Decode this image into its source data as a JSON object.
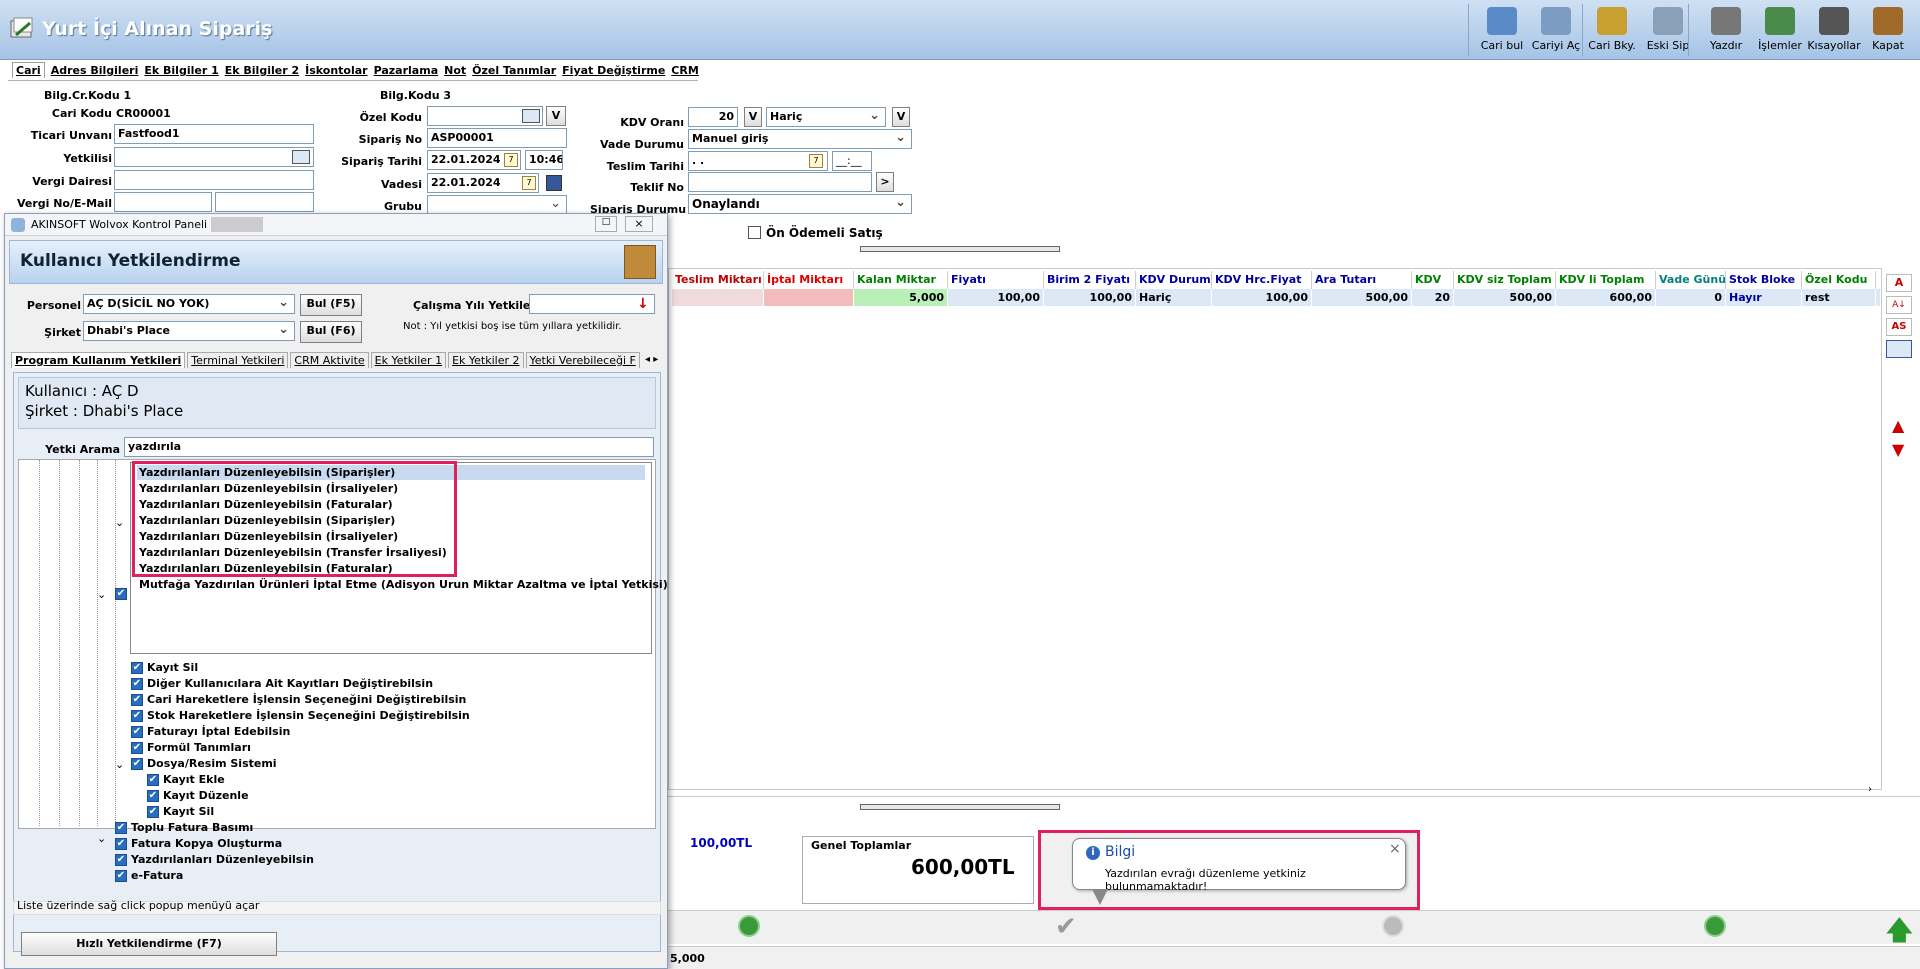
{
  "window": {
    "title": "Yurt İçi Alınan Sipariş"
  },
  "toolbar": [
    {
      "label": "Cari bul",
      "icon": "user-search-icon"
    },
    {
      "label": "Cariyi Aç",
      "icon": "user-open-icon"
    },
    {
      "label": "Cari Bky.",
      "icon": "balance-icon"
    },
    {
      "label": "Eski Sip",
      "icon": "old-orders-icon"
    },
    {
      "label": "Yazdır",
      "icon": "printer-icon"
    },
    {
      "label": "İşlemler",
      "icon": "operations-icon"
    },
    {
      "label": "Kısayollar",
      "icon": "keyboard-icon"
    },
    {
      "label": "Kapat",
      "icon": "exit-door-icon"
    }
  ],
  "tabs": [
    "Cari",
    "Adres Bilgileri",
    "Ek Bilgiler 1",
    "Ek Bilgiler 2",
    "İskontolar",
    "Pazarlama",
    "Not",
    "Özel Tanımlar",
    "Fiyat Değiştirme",
    "CRM"
  ],
  "form": {
    "bilg_cr_kodu": "Bilg.Cr.Kodu 1",
    "bilg_kodu": "Bilg.Kodu 3",
    "cari_kodu_label": "Cari Kodu",
    "cari_kodu": "CR00001",
    "ticari_unvani_label": "Ticari Unvanı",
    "ticari_unvani": "Fastfood1",
    "yetkilisi_label": "Yetkilisi",
    "yetkilisi": "",
    "vergi_dairesi_label": "Vergi Dairesi",
    "vergi_dairesi": "",
    "vergi_no_label": "Vergi No/E-Mail",
    "ozel_kodu_label": "Özel Kodu",
    "ozel_kodu": "",
    "siparis_no_label": "Sipariş No",
    "siparis_no": "ASP00001",
    "siparis_tarihi_label": "Sipariş Tarihi",
    "siparis_tarihi": "22.01.2024",
    "siparis_saati": "10:46",
    "vadesi_label": "Vadesi",
    "vadesi": "22.01.2024",
    "grubu_label": "Grubu",
    "grubu": "",
    "kdv_orani_label": "KDV Oranı",
    "kdv_orani": "20",
    "kdv_durum": "Hariç",
    "vade_durumu_label": "Vade Durumu",
    "vade_durumu": "Manuel giriş",
    "teslim_tarihi_label": "Teslim Tarihi",
    "teslim_tarihi": ". .",
    "teslim_saati": "__:__",
    "teklif_no_label": "Teklif No",
    "teklif_no": "",
    "siparis_durumu_label": "Sipariş Durumu",
    "siparis_durumu": "Onaylandı",
    "on_odemeli_label": "Ön Ödemeli Satış",
    "v_btn": "V",
    "arrow_btn": ">"
  },
  "grid": {
    "headers": [
      {
        "text": "Teslim Miktarı",
        "color": "#c00000"
      },
      {
        "text": "İptal Miktarı",
        "color": "#e00000"
      },
      {
        "text": "Kalan Miktar",
        "color": "#008000"
      },
      {
        "text": "Fiyatı",
        "color": "#0000a0"
      },
      {
        "text": "Birim 2 Fiyatı",
        "color": "#0000a0"
      },
      {
        "text": "KDV Durumu",
        "color": "#0000a0"
      },
      {
        "text": "KDV Hrc.Fiyat",
        "color": "#0000a0"
      },
      {
        "text": "Ara Tutarı",
        "color": "#0000a0"
      },
      {
        "text": "KDV",
        "color": "#008000"
      },
      {
        "text": "KDV siz Toplam",
        "color": "#008000"
      },
      {
        "text": "KDV li Toplam",
        "color": "#008000"
      },
      {
        "text": "Vade Günü",
        "color": "#008080"
      },
      {
        "text": "Stok Bloke",
        "color": "#0000a0"
      },
      {
        "text": "Özel Kodu",
        "color": "#008000"
      }
    ],
    "row": [
      "",
      "",
      "5,000",
      "100,00",
      "100,00",
      "Hariç",
      "100,00",
      "500,00",
      "20",
      "500,00",
      "600,00",
      "0",
      "Hayır",
      "rest"
    ]
  },
  "side_icons": [
    "sort-a-icon",
    "sort-az-icon",
    "as-icon",
    "filter-icon",
    "arrow-up-icon",
    "arrow-down-icon"
  ],
  "side_labels": {
    "a": "A",
    "as": "AS"
  },
  "totals": {
    "left_value": "100,00TL",
    "genel_label": "Genel Toplamlar",
    "genel_value": "600,00TL",
    "bottom_fragment": "5,000"
  },
  "notification": {
    "title": "Bilgi",
    "message": "Yazdırılan evrağı düzenleme yetkiniz bulunmamaktadır!",
    "close": "×"
  },
  "panel": {
    "window_title": "AKINSOFT Wolvox Kontrol Paneli",
    "heading": "Kullanıcı Yetkilendirme",
    "personel_label": "Personel",
    "personel_value": "AÇ D(SİCİL NO YOK)",
    "sirket_label": "Şirket",
    "sirket_value": "Dhabi's Place",
    "bul_f5": "Bul (F5)",
    "bul_f6": "Bul (F6)",
    "calisma_label": "Çalışma Yılı Yetkileri",
    "note": "Not : Yıl yetkisi boş ise tüm yıllara yetkilidir.",
    "tabs": [
      "Program Kullanım Yetkileri",
      "Terminal Yetkileri",
      "CRM Aktivite",
      "Ek Yetkiler 1",
      "Ek Yetkiler 2",
      "Yetki Verebileceği F"
    ],
    "kullanici": "Kullanıcı : AÇ D",
    "sirket_info": "Şirket : Dhabi's Place",
    "arama_label": "Yetki Arama",
    "arama_value": "yazdırıla",
    "search_results": [
      "Yazdırılanları Düzenleyebilsin (Siparişler)",
      "Yazdırılanları Düzenleyebilsin (İrsaliyeler)",
      "Yazdırılanları Düzenleyebilsin (Faturalar)",
      "Yazdırılanları Düzenleyebilsin (Siparişler)",
      "Yazdırılanları Düzenleyebilsin (İrsaliyeler)",
      "Yazdırılanları Düzenleyebilsin (Transfer İrsaliyesi)",
      "Yazdırılanları Düzenleyebilsin (Faturalar)",
      "Mutfağa Yazdırılan Ürünleri İptal Etme (Adisyon Urun Miktar Azaltma ve İptal Yetkisi)"
    ],
    "tree_items": [
      {
        "text": "Kayıt Sil",
        "level": 2
      },
      {
        "text": "Diğer Kullanıcılara Ait Kayıtları Değiştirebilsin",
        "level": 2
      },
      {
        "text": "Cari Hareketlere İşlensin Seçeneğini Değiştirebilsin",
        "level": 2
      },
      {
        "text": "Stok Hareketlere İşlensin Seçeneğini Değiştirebilsin",
        "level": 2
      },
      {
        "text": "Faturayı İptal Edebilsin",
        "level": 2
      },
      {
        "text": "Formül Tanımları",
        "level": 2
      },
      {
        "text": "Dosya/Resim Sistemi",
        "level": 2
      },
      {
        "text": "Kayıt Ekle",
        "level": 3
      },
      {
        "text": "Kayıt Düzenle",
        "level": 3
      },
      {
        "text": "Kayıt Sil",
        "level": 3
      },
      {
        "text": "Toplu Fatura Basımı",
        "level": 1
      },
      {
        "text": "Fatura Kopya Oluşturma",
        "level": 1
      },
      {
        "text": "Yazdırılanları Düzenleyebilsin",
        "level": 1
      },
      {
        "text": "e-Fatura",
        "level": 1
      }
    ],
    "status_text": "Liste üzerinde sağ click popup menüyü açar",
    "hizli_btn": "Hızlı Yetkilendirme (F7)"
  }
}
